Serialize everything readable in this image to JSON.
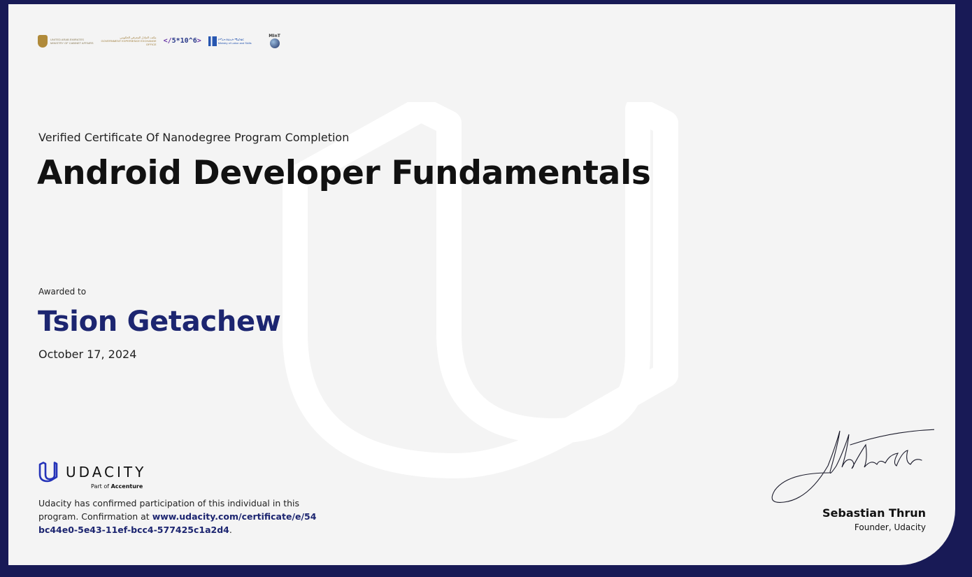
{
  "certificate": {
    "subtitle": "Verified Certificate Of Nanodegree Program Completion",
    "program_title": "Android Developer Fundamentals",
    "awarded_to_label": "Awarded to",
    "recipient_name": "Tsion Getachew",
    "date": "October 17, 2024"
  },
  "partner_logos": [
    {
      "name": "uae-logo",
      "line1": "UNITED ARAB EMIRATES",
      "line2": "MINISTRY OF CABINET AFFAIRS"
    },
    {
      "name": "gov-exchange-logo",
      "text": "مكتب التبادل المعرفي الحكومي",
      "sub": "GOVERNMENT EXPERIENCE EXCHANGE OFFICE"
    },
    {
      "name": "5-million-coders-logo",
      "text": "5*10^6"
    },
    {
      "name": "mols-logo",
      "line1": "የሥራና ክህሎት ሚኒስቴር",
      "line2": "Ministry of Labor and Skills"
    },
    {
      "name": "mint-logo",
      "text": "MInT"
    }
  ],
  "udacity": {
    "wordmark": "UDACITY",
    "part_of_prefix": "Part of ",
    "part_of_brand": "Accenture",
    "confirm_prefix": "Udacity has confirmed participation of this individual in this program. Confirmation at ",
    "confirm_url": "www.udacity.com/certificate/e/54bc44e0-5e43-11ef-bcc4-577425c1a2d4",
    "confirm_suffix": "."
  },
  "signatory": {
    "name": "Sebastian Thrun",
    "role": "Founder, Udacity"
  },
  "colors": {
    "frame": "#181a56",
    "card": "#f4f4f4",
    "accent_navy": "#1c2570"
  }
}
